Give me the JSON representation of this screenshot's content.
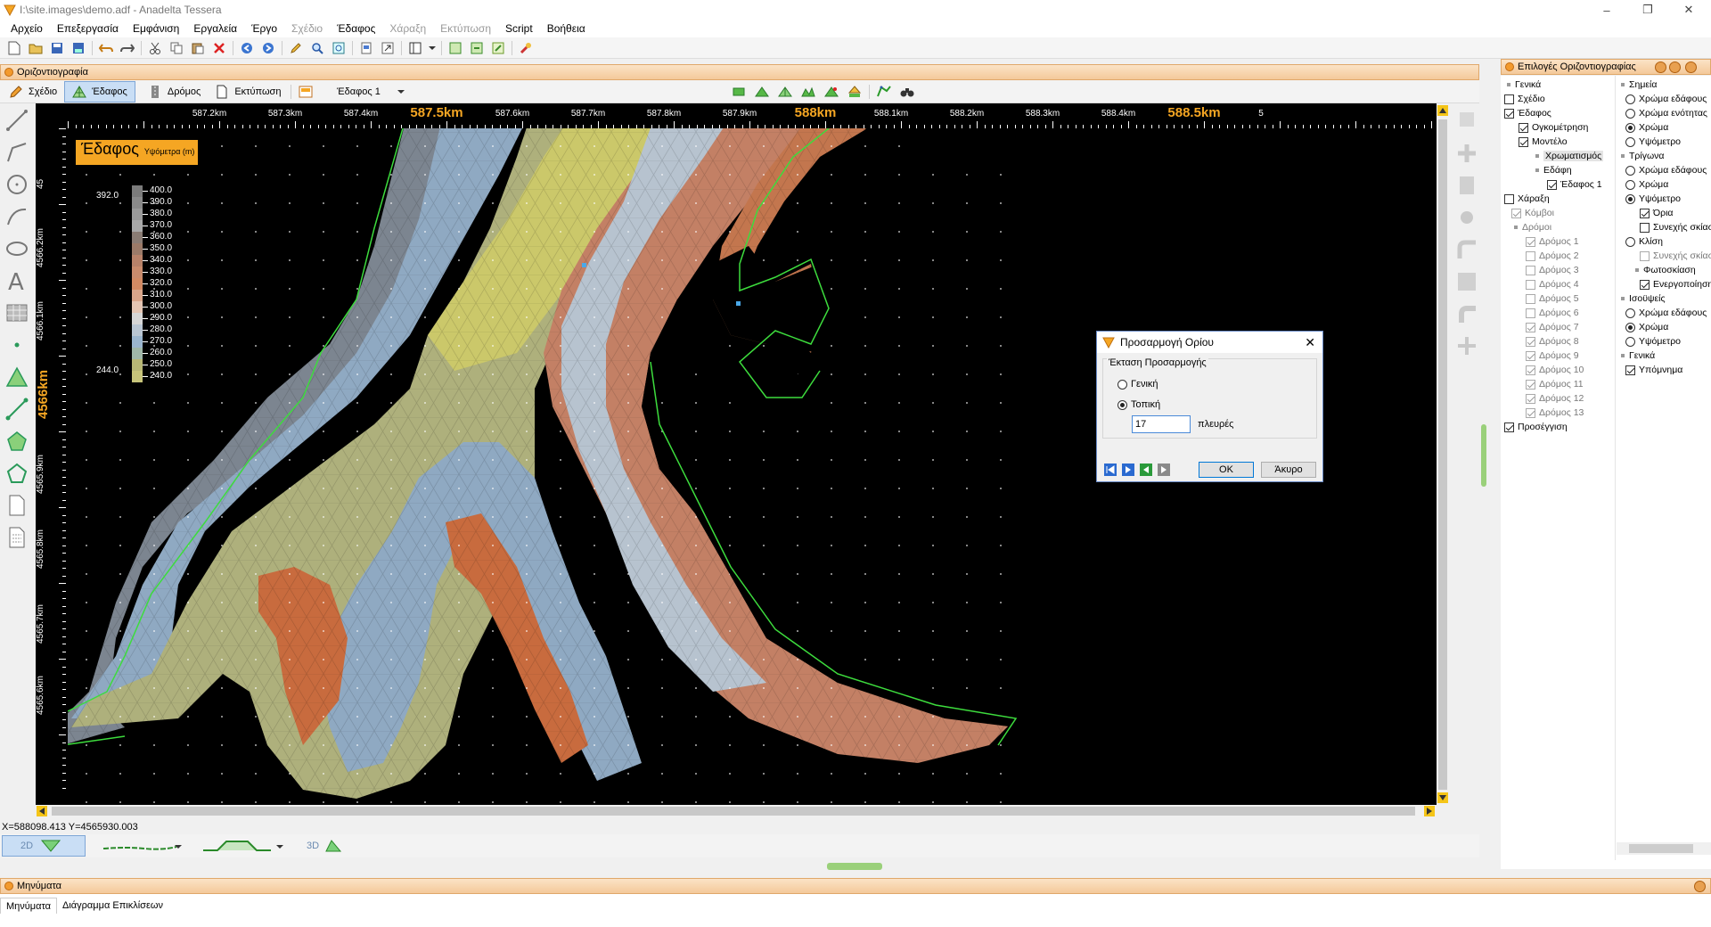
{
  "window": {
    "title": "I:\\site.images\\demo.adf - Anadelta Tessera"
  },
  "menu": [
    "Αρχείο",
    "Επεξεργασία",
    "Εμφάνιση",
    "Εργαλεία",
    "Έργο",
    "Σχέδιο",
    "Έδαφος",
    "Χάραξη",
    "Εκτύπωση",
    "Script",
    "Βοήθεια"
  ],
  "menu_disabled": [
    false,
    false,
    false,
    false,
    false,
    true,
    false,
    true,
    true,
    false,
    false
  ],
  "panel": {
    "title": "Οριζοντιογραφία"
  },
  "modebar": {
    "modes": [
      "Σχέδιο",
      "Έδαφος",
      "Δρόμος",
      "Εκτύπωση"
    ],
    "active_mode": "Έδαφος",
    "terrain_select": "Έδαφος 1"
  },
  "ruler": {
    "x_labels": [
      "587.2km",
      "587.3km",
      "587.4km",
      "587.5km",
      "587.6km",
      "587.7km",
      "587.8km",
      "587.9km",
      "588km",
      "588.1km",
      "588.2km",
      "588.3km",
      "588.4km",
      "588.5km",
      "5"
    ],
    "x_major": [
      "587.5km",
      "588km",
      "588.5km"
    ],
    "y_labels": [
      "45",
      "4566.2km",
      "4566.1km",
      "4566km",
      "4565.9km",
      "4565.8km",
      "4565.7km",
      "4565.6km"
    ],
    "y_major": [
      "4566km"
    ]
  },
  "legend": {
    "title": "Έδαφος",
    "subtitle": "Υψόμετρα (m)",
    "max_label": "392.0",
    "min_label": "244.0",
    "levels": [
      "400.0",
      "390.0",
      "380.0",
      "370.0",
      "360.0",
      "350.0",
      "340.0",
      "330.0",
      "320.0",
      "310.0",
      "300.0",
      "290.0",
      "280.0",
      "270.0",
      "260.0",
      "250.0",
      "240.0"
    ],
    "colors": [
      "#7b7b7b",
      "#8a8a8a",
      "#9a9a9a",
      "#a9a9a9",
      "#8a7c74",
      "#9b7a68",
      "#b88269",
      "#c98b6c",
      "#d28a63",
      "#d9a58a",
      "#e4c5b3",
      "#d6d6d6",
      "#b9c6d3",
      "#9bb6cf",
      "#a0b7a8",
      "#b8b775",
      "#c7c47a"
    ]
  },
  "dialog": {
    "title": "Προσαρμογή Ορίου",
    "group": "Έκταση Προσαρμογής",
    "option_general": "Γενική",
    "option_local": "Τοπική",
    "selected": "Τοπική",
    "value": "17",
    "unit": "πλευρές",
    "ok": "OK",
    "cancel": "Άκυρο"
  },
  "options_panel": {
    "title": "Επιλογές Οριζοντιογραφίας",
    "tree": [
      {
        "label": "Γενικά",
        "type": "bullet"
      },
      {
        "label": "Σχέδιο",
        "type": "cb",
        "checked": false
      },
      {
        "label": "Έδαφος",
        "type": "cb",
        "checked": true
      },
      {
        "label": "Ογκομέτρηση",
        "type": "cb",
        "checked": true
      },
      {
        "label": "Μοντέλο",
        "type": "cb",
        "checked": true
      },
      {
        "label": "Χρωματισμός",
        "type": "bullet",
        "selected": true
      },
      {
        "label": "Εδάφη",
        "type": "bullet"
      },
      {
        "label": "Έδαφος 1",
        "type": "cb",
        "checked": true
      },
      {
        "label": "Χάραξη",
        "type": "cb",
        "checked": false
      },
      {
        "label": "Κόμβοι",
        "type": "cb",
        "checked": true,
        "disabled": true
      },
      {
        "label": "Δρόμοι",
        "type": "bullet",
        "disabled": true
      },
      {
        "label": "Δρόμος 1",
        "type": "cb",
        "checked": true,
        "disabled": true
      },
      {
        "label": "Δρόμος 2",
        "type": "cb",
        "checked": false,
        "disabled": true
      },
      {
        "label": "Δρόμος 3",
        "type": "cb",
        "checked": false,
        "disabled": true
      },
      {
        "label": "Δρόμος 4",
        "type": "cb",
        "checked": false,
        "disabled": true
      },
      {
        "label": "Δρόμος 5",
        "type": "cb",
        "checked": false,
        "disabled": true
      },
      {
        "label": "Δρόμος 6",
        "type": "cb",
        "checked": false,
        "disabled": true
      },
      {
        "label": "Δρόμος 7",
        "type": "cb",
        "checked": true,
        "disabled": true
      },
      {
        "label": "Δρόμος 8",
        "type": "cb",
        "checked": true,
        "disabled": true
      },
      {
        "label": "Δρόμος 9",
        "type": "cb",
        "checked": true,
        "disabled": true
      },
      {
        "label": "Δρόμος 10",
        "type": "cb",
        "checked": true,
        "disabled": true
      },
      {
        "label": "Δρόμος 11",
        "type": "cb",
        "checked": true,
        "disabled": true
      },
      {
        "label": "Δρόμος 12",
        "type": "cb",
        "checked": true,
        "disabled": true
      },
      {
        "label": "Δρόμος 13",
        "type": "cb",
        "checked": true,
        "disabled": true
      },
      {
        "label": "Προσέγγιση",
        "type": "cb",
        "checked": true
      }
    ],
    "props": [
      {
        "label": "Σημεία",
        "type": "bullet"
      },
      {
        "label": "Χρώμα εδάφους",
        "type": "rb",
        "checked": false
      },
      {
        "label": "Χρώμα ενότητας",
        "type": "rb",
        "checked": false
      },
      {
        "label": "Χρώμα",
        "type": "rb",
        "checked": true
      },
      {
        "label": "Υψόμετρο",
        "type": "rb",
        "checked": false
      },
      {
        "label": "Τρίγωνα",
        "type": "bullet"
      },
      {
        "label": "Χρώμα εδάφους",
        "type": "rb",
        "checked": false
      },
      {
        "label": "Χρώμα",
        "type": "rb",
        "checked": false
      },
      {
        "label": "Υψόμετρο",
        "type": "rb",
        "checked": true
      },
      {
        "label": "Όρια",
        "type": "cb",
        "checked": true
      },
      {
        "label": "Συνεχής σκίαση",
        "type": "cb",
        "checked": false
      },
      {
        "label": "Κλίση",
        "type": "rb",
        "checked": false
      },
      {
        "label": "Συνεχής σκίαση",
        "type": "cb",
        "checked": false,
        "disabled": true
      },
      {
        "label": "Φωτοσκίαση",
        "type": "bullet"
      },
      {
        "label": "Ενεργοποίηση",
        "type": "cb",
        "checked": true
      },
      {
        "label": "Ισοϋψείς",
        "type": "bullet"
      },
      {
        "label": "Χρώμα εδάφους",
        "type": "rb",
        "checked": false
      },
      {
        "label": "Χρώμα",
        "type": "rb",
        "checked": true
      },
      {
        "label": "Υψόμετρο",
        "type": "rb",
        "checked": false
      },
      {
        "label": "Γενικά",
        "type": "bullet"
      },
      {
        "label": "Υπόμνημα",
        "type": "cb",
        "checked": true
      }
    ]
  },
  "status": {
    "coords": "X=588098.413  Y=4565930.003"
  },
  "viewbar": {
    "view2d": "2D",
    "view3d": "3D"
  },
  "messages": {
    "title": "Μηνύματα",
    "tabs": [
      "Μηνύματα",
      "Διάγραμμα Επικλίσεων"
    ]
  },
  "colors": {
    "accent": "#f5a623",
    "boundary": "#3ddc3d",
    "panel_header": "#f4c99a"
  }
}
